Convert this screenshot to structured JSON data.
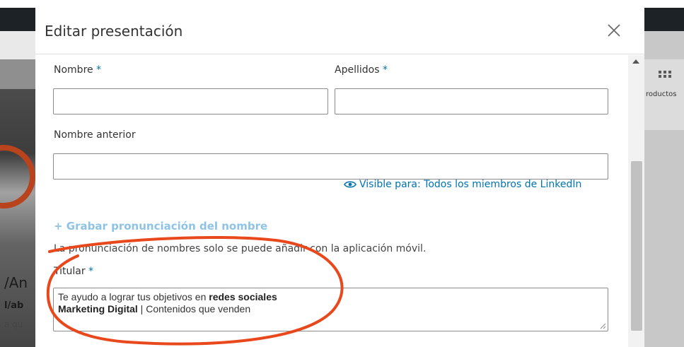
{
  "modal": {
    "title": "Editar presentación",
    "close_icon": "close-icon"
  },
  "form": {
    "first_name": {
      "label": "Nombre",
      "required_mark": "*",
      "value": ""
    },
    "last_name": {
      "label": "Apellidos",
      "required_mark": "*",
      "value": ""
    },
    "former_name": {
      "label": "Nombre anterior",
      "value": ""
    },
    "visibility": {
      "icon": "eye-icon",
      "text": "Visible para: Todos los miembros de LinkedIn"
    },
    "pronunciation": {
      "link": "+ Grabar pronunciación del nombre",
      "note": "La pronunciación de nombres solo se puede añadir con la aplicación móvil."
    },
    "headline": {
      "label": "Titular",
      "required_mark": "*",
      "line1_prefix": "Te ayudo a lograr tus objetivos en ",
      "line1_bold": "redes sociales",
      "line2_bold": "Marketing Digital",
      "line2_rest": " | Contenidos que venden"
    }
  },
  "background": {
    "left_text_1": "/An",
    "left_text_2": "l/ab",
    "left_text_3": "a qu",
    "right_label": "roductos"
  },
  "colors": {
    "accent": "#0073b1",
    "annotation": "#e8481c"
  }
}
